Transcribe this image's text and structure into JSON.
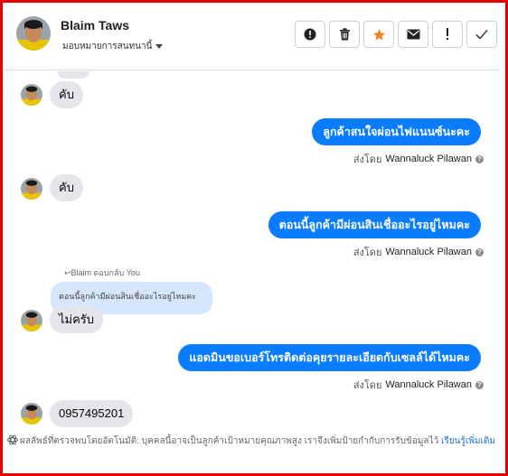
{
  "header": {
    "name": "Blaim Taws",
    "assign_label": "มอบหมายการสนทนานี้"
  },
  "toolbar": {
    "buttons": [
      {
        "name": "report-spam-button",
        "icon": "exclamation-circle-icon"
      },
      {
        "name": "delete-button",
        "icon": "trash-icon"
      },
      {
        "name": "star-button",
        "icon": "star-icon",
        "color": "#f58220"
      },
      {
        "name": "mark-unread-button",
        "icon": "envelope-icon"
      },
      {
        "name": "follow-up-button",
        "icon": "exclamation-icon"
      },
      {
        "name": "done-button",
        "icon": "checkmark-icon"
      }
    ]
  },
  "messages": {
    "m1": "คับ",
    "m2": "ลูกค้าสนใจผ่อนไฟแนนซ์นะคะ",
    "m3": "คับ",
    "m4": "ตอนนี้ลูกค้ามีผ่อนสินเชื่ออะไรอยู่ไหมคะ",
    "reply_header": "Blaim ตอบกลับ You",
    "quote": "ตอนนี้ลูกค้ามีผ่อนสินเชื่ออะไรอยู่ไหมคะ",
    "m5": "ไม่ครับ",
    "m6": "แอดมินขอเบอร์โทรติดต่อคุยรายละเอียดกับเซลล์ได้ไหมคะ",
    "m7": "0957495201"
  },
  "sent_by": {
    "prefix": "ส่งโดย",
    "agent": "Wannaluck Pilawan"
  },
  "footer": {
    "text": "ผลลัพธ์ที่ตรวจพบโดยอัตโนมัติ: บุคคลนี้อาจเป็นลูกค้าเป้าหมายคุณภาพสูง เราจึงเพิ่มป้ายกำกับการรับข้อมูลไว้",
    "link": "เรียนรู้เพิ่มเติม"
  },
  "colors": {
    "accent": "#0a7cff",
    "incoming_bubble": "#e4e6eb",
    "quote_bubble": "#d6e6fc",
    "frame": "#e60000"
  }
}
